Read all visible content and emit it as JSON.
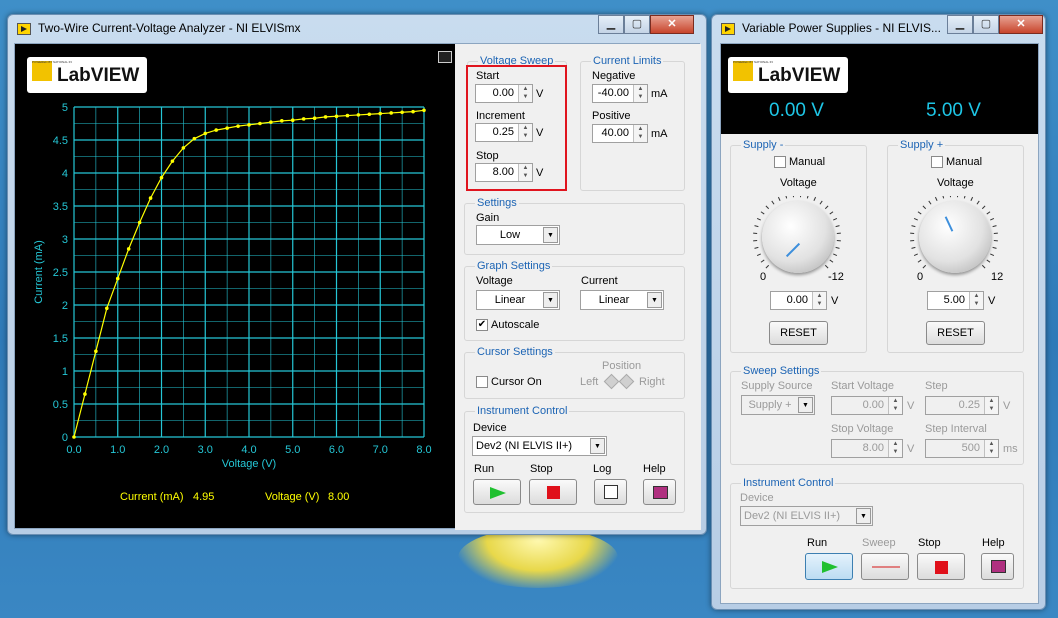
{
  "analyzer": {
    "title": "Two-Wire Current-Voltage Analyzer - NI ELVISmx",
    "logo_small": "POWERED BY NATIONAL INSTRUMENTS",
    "logo": "LabVIEW",
    "graph": {
      "ylabel": "Current (mA)",
      "xlabel": "Voltage (V)",
      "xticks": [
        "0.0",
        "1.0",
        "2.0",
        "3.0",
        "4.0",
        "5.0",
        "6.0",
        "7.0",
        "8.0"
      ],
      "yticks": [
        "0",
        "0.5",
        "1",
        "1.5",
        "2",
        "2.5",
        "3",
        "3.5",
        "4",
        "4.5",
        "5"
      ],
      "readout_current_label": "Current (mA)",
      "readout_current": "4.95",
      "readout_voltage_label": "Voltage (V)",
      "readout_voltage": "8.00"
    },
    "voltage_sweep": {
      "title": "Voltage Sweep",
      "start_label": "Start",
      "start": "0.00",
      "increment_label": "Increment",
      "increment": "0.25",
      "stop_label": "Stop",
      "stop": "8.00",
      "unit": "V"
    },
    "current_limits": {
      "title": "Current Limits",
      "negative_label": "Negative",
      "negative": "-40.00",
      "positive_label": "Positive",
      "positive": "40.00",
      "unit": "mA"
    },
    "settings": {
      "title": "Settings",
      "gain_label": "Gain",
      "gain": "Low"
    },
    "graph_settings": {
      "title": "Graph Settings",
      "voltage_label": "Voltage",
      "voltage": "Linear",
      "current_label": "Current",
      "current": "Linear",
      "autoscale_label": "Autoscale"
    },
    "cursor_settings": {
      "title": "Cursor Settings",
      "cursor_on_label": "Cursor On",
      "position_label": "Position",
      "left_label": "Left",
      "right_label": "Right"
    },
    "instrument_control": {
      "title": "Instrument Control",
      "device_label": "Device",
      "device": "Dev2 (NI ELVIS II+)",
      "run_label": "Run",
      "stop_label": "Stop",
      "log_label": "Log",
      "help_label": "Help"
    }
  },
  "chart_data": {
    "type": "line",
    "x": [
      0,
      0.25,
      0.5,
      0.75,
      1,
      1.25,
      1.5,
      1.75,
      2,
      2.25,
      2.5,
      2.75,
      3,
      3.25,
      3.5,
      3.75,
      4,
      4.25,
      4.5,
      4.75,
      5,
      5.25,
      5.5,
      5.75,
      6,
      6.25,
      6.5,
      6.75,
      7,
      7.25,
      7.5,
      7.75,
      8
    ],
    "y": [
      0,
      0.65,
      1.3,
      1.95,
      2.4,
      2.85,
      3.25,
      3.62,
      3.93,
      4.18,
      4.38,
      4.52,
      4.6,
      4.65,
      4.68,
      4.71,
      4.73,
      4.75,
      4.77,
      4.79,
      4.8,
      4.82,
      4.83,
      4.85,
      4.86,
      4.87,
      4.88,
      4.89,
      4.9,
      4.91,
      4.92,
      4.93,
      4.95
    ],
    "xlabel": "Voltage (V)",
    "ylabel": "Current (mA)",
    "xlim": [
      0,
      8
    ],
    "ylim": [
      0,
      5
    ],
    "grid": true,
    "line_color": "#ffff00",
    "grid_color": "#25c7d6"
  },
  "supplies": {
    "title": "Variable Power Supplies - NI ELVIS...",
    "logo_small": "POWERED BY NATIONAL INSTRUMENTS",
    "logo": "LabVIEW",
    "display_neg": "0.00 V",
    "display_pos": "5.00 V",
    "supply_neg": {
      "title": "Supply -",
      "manual_label": "Manual",
      "voltage_label": "Voltage",
      "min": "0",
      "max": "-12",
      "value": "0.00",
      "unit": "V",
      "reset_label": "RESET"
    },
    "supply_pos": {
      "title": "Supply +",
      "manual_label": "Manual",
      "voltage_label": "Voltage",
      "min": "0",
      "max": "12",
      "value": "5.00",
      "unit": "V",
      "reset_label": "RESET"
    },
    "sweep": {
      "title": "Sweep Settings",
      "source_label": "Supply Source",
      "source": "Supply +",
      "start_label": "Start Voltage",
      "start": "0.00",
      "step_label": "Step",
      "step": "0.25",
      "stop_label": "Stop Voltage",
      "stop": "8.00",
      "interval_label": "Step Interval",
      "interval": "500",
      "unit_v": "V",
      "unit_ms": "ms"
    },
    "instrument_control": {
      "title": "Instrument Control",
      "device_label": "Device",
      "device": "Dev2 (NI ELVIS II+)",
      "run_label": "Run",
      "sweep_label": "Sweep",
      "stop_label": "Stop",
      "help_label": "Help"
    }
  }
}
